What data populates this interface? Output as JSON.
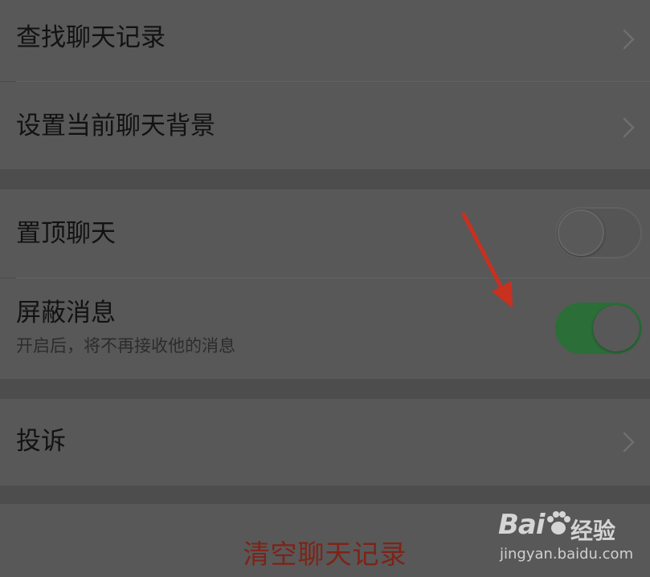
{
  "menu": {
    "search_history": "查找聊天记录",
    "set_background": "设置当前聊天背景",
    "pin_chat": "置顶聊天",
    "mute": "屏蔽消息",
    "mute_desc": "开启后，将不再接收他的消息",
    "complain": "投诉",
    "clear_history": "清空聊天记录"
  },
  "toggles": {
    "pin_chat_on": false,
    "mute_on": true
  },
  "watermark": {
    "brand": "Bai",
    "brand2": "du",
    "cn": "经验",
    "url": "jingyan.baidu.com"
  },
  "colors": {
    "overlay_bg": "#4d4d4d",
    "row_bg": "#585858",
    "toggle_on": "#2b6e38",
    "danger_text": "#7d2318",
    "arrow": "#c8301f"
  }
}
